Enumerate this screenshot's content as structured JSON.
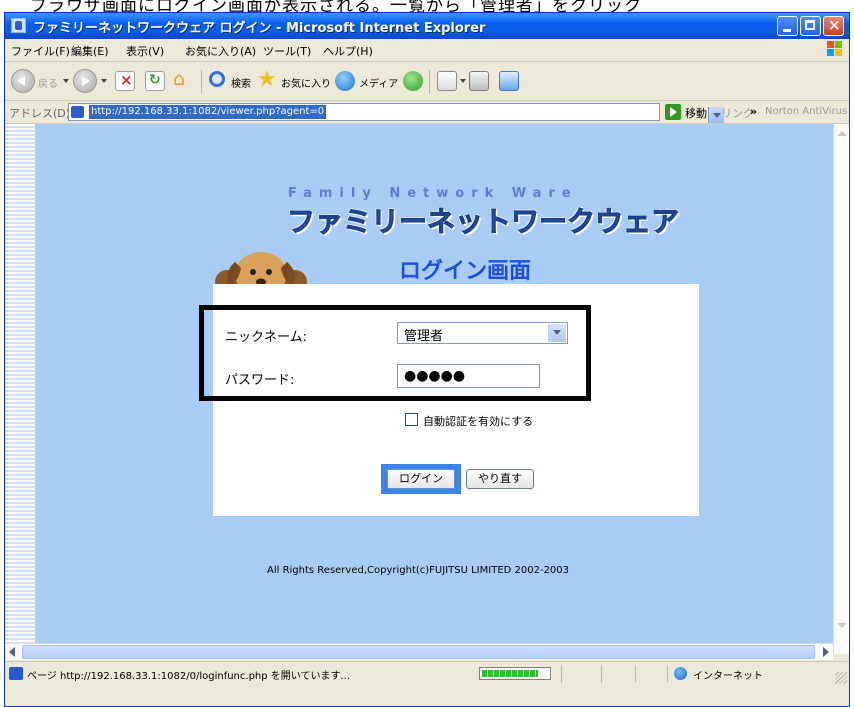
{
  "top_strip_text": "ブラウザ画面にログイン画面が表示される。一覧から「管理者」をクリック",
  "window": {
    "title": "ファミリーネットワークウェア ログイン - Microsoft Internet Explorer"
  },
  "menubar": {
    "items": [
      "ファイル(F)",
      "編集(E)",
      "表示(V)",
      "お気に入り(A)",
      "ツール(T)",
      "ヘルプ(H)"
    ]
  },
  "toolbar": {
    "back_label": "戻る",
    "search_label": "検索",
    "favorites_label": "お気に入り",
    "media_label": "メディア"
  },
  "addressbar": {
    "label": "アドレス(D)",
    "url": "http://192.168.33.1:1082/viewer.php?agent=0",
    "go_label": "移動",
    "links_label": "リンク",
    "chevron": "»",
    "norton_label": "Norton AntiVirus"
  },
  "page": {
    "logo_subtitle": "Family Network Ware",
    "logo_title": "ファミリーネットワークウェア",
    "heading": "ログイン画面",
    "nickname_label": "ニックネーム:",
    "nickname_value": "管理者",
    "password_label": "パスワード:",
    "password_value": "●●●●●",
    "auto_auth_label": "自動認証を有効にする",
    "login_button": "ログイン",
    "reset_button": "やり直す",
    "copyright": "All Rights Reserved,Copyright(c)FUJITSU LIMITED 2002-2003"
  },
  "statusbar": {
    "text": "ページ http://192.168.33.1:1082/0/loginfunc.php を開いています...",
    "progress": 0.85,
    "zone": "インターネット"
  },
  "colors": {
    "page_background": "#a9ccf5",
    "titlebar": "#0a5ff0",
    "heading": "#1d4fe0",
    "highlight": "#000000"
  },
  "icons": [
    "back-icon",
    "forward-icon",
    "stop-icon",
    "refresh-icon",
    "home-icon",
    "search-icon",
    "favorites-icon",
    "media-icon",
    "history-icon",
    "mail-icon",
    "print-icon",
    "edit-icon"
  ]
}
